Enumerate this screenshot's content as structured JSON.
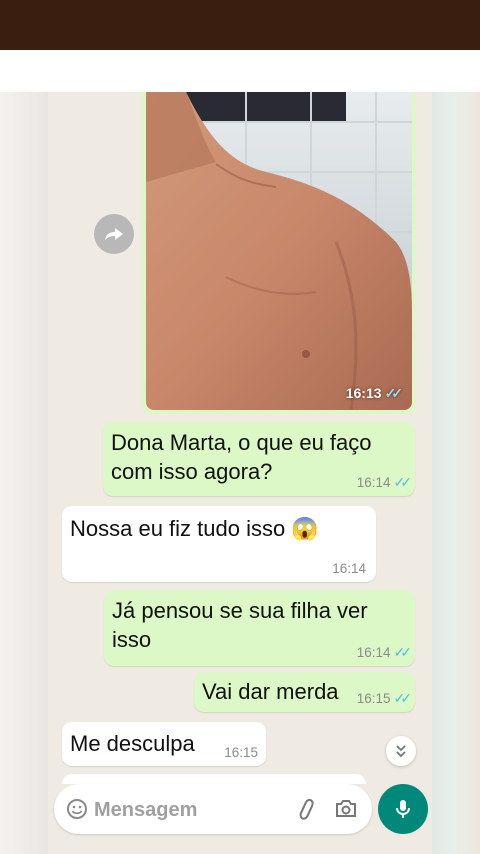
{
  "messages": [
    {
      "id": "photo",
      "direction": "out",
      "type": "image",
      "time": "16:13",
      "read_ticks": "✓✓"
    },
    {
      "id": "m1",
      "direction": "out",
      "text": "Dona Marta, o que eu faço\ncom isso agora?",
      "time": "16:14",
      "read_ticks": "✓✓"
    },
    {
      "id": "m2",
      "direction": "in",
      "text": "Nossa eu fiz tudo isso 😱",
      "time": "16:14"
    },
    {
      "id": "m3",
      "direction": "out",
      "text": "Já pensou se sua filha ver\nisso",
      "time": "16:14",
      "read_ticks": "✓✓"
    },
    {
      "id": "m4",
      "direction": "out",
      "text": "Vai dar merda",
      "time": "16:15",
      "read_ticks": "✓✓"
    },
    {
      "id": "m5",
      "direction": "in",
      "text": "Me desculpa",
      "time": "16:15"
    }
  ],
  "composer": {
    "placeholder": "Mensagem"
  },
  "icons": {
    "forward": "forward-icon",
    "scroll_down": "chevron-double-down-icon",
    "emoji": "emoji-icon",
    "attach": "paperclip-icon",
    "camera": "camera-icon",
    "mic": "microphone-icon"
  },
  "colors": {
    "outgoing_bubble": "#dcf8c6",
    "incoming_bubble": "#ffffff",
    "chat_background": "#efeae2",
    "read_tick": "#53bdeb",
    "mic_button": "#00897b"
  }
}
